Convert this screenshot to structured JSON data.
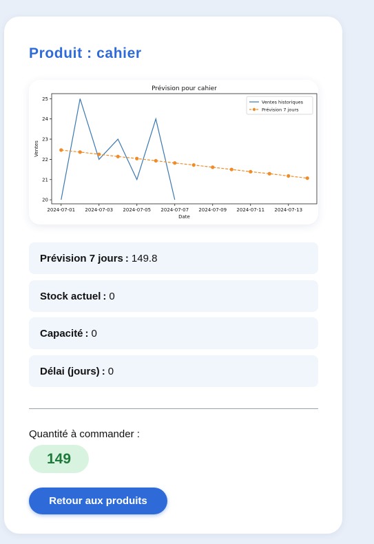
{
  "page": {
    "title": "Produit : cahier"
  },
  "chart_data": {
    "type": "line",
    "title": "Prévision pour cahier",
    "xlabel": "Date",
    "ylabel": "Ventes",
    "x_tick_labels": [
      "2024-07-01",
      "2024-07-03",
      "2024-07-05",
      "2024-07-07",
      "2024-07-09",
      "2024-07-11",
      "2024-07-13"
    ],
    "y_tick_labels": [
      "20",
      "21",
      "22",
      "23",
      "24",
      "25"
    ],
    "ylim": [
      19.8,
      25.25
    ],
    "xlim_days": [
      0,
      13
    ],
    "legend_position": "top-right",
    "series": [
      {
        "name": "Ventes historiques",
        "color": "#3a78b3",
        "style": "solid",
        "x": [
          "2024-07-01",
          "2024-07-02",
          "2024-07-03",
          "2024-07-04",
          "2024-07-05",
          "2024-07-06",
          "2024-07-07"
        ],
        "values": [
          20,
          25,
          22,
          23,
          21,
          24,
          20
        ]
      },
      {
        "name": "Prévision 7 jours",
        "color": "#f08c28",
        "style": "dashed",
        "marker": "circle",
        "x": [
          "2024-07-01",
          "2024-07-02",
          "2024-07-03",
          "2024-07-04",
          "2024-07-05",
          "2024-07-06",
          "2024-07-07",
          "2024-07-08",
          "2024-07-09",
          "2024-07-10",
          "2024-07-11",
          "2024-07-12",
          "2024-07-13",
          "2024-07-14"
        ],
        "values": [
          22.46,
          22.36,
          22.25,
          22.14,
          22.04,
          21.93,
          21.82,
          21.72,
          21.61,
          21.5,
          21.39,
          21.29,
          21.18,
          21.07
        ]
      }
    ]
  },
  "details": [
    {
      "label": "Prévision 7 jours",
      "separator": ":",
      "value": "149.8"
    },
    {
      "label": "Stock actuel",
      "separator": ":",
      "value": "0"
    },
    {
      "label": "Capacité",
      "separator": ":",
      "value": "0"
    },
    {
      "label": "Délai (jours)",
      "separator": ":",
      "value": "0"
    }
  ],
  "order": {
    "label": "Quantité à commander :",
    "quantity": "149"
  },
  "back_button": {
    "label": "Retour aux produits"
  },
  "colors": {
    "accent": "#2f6bd8",
    "badge_bg": "#d8f3e0",
    "badge_text": "#1d7a3a",
    "row_bg": "#f1f5fc"
  }
}
